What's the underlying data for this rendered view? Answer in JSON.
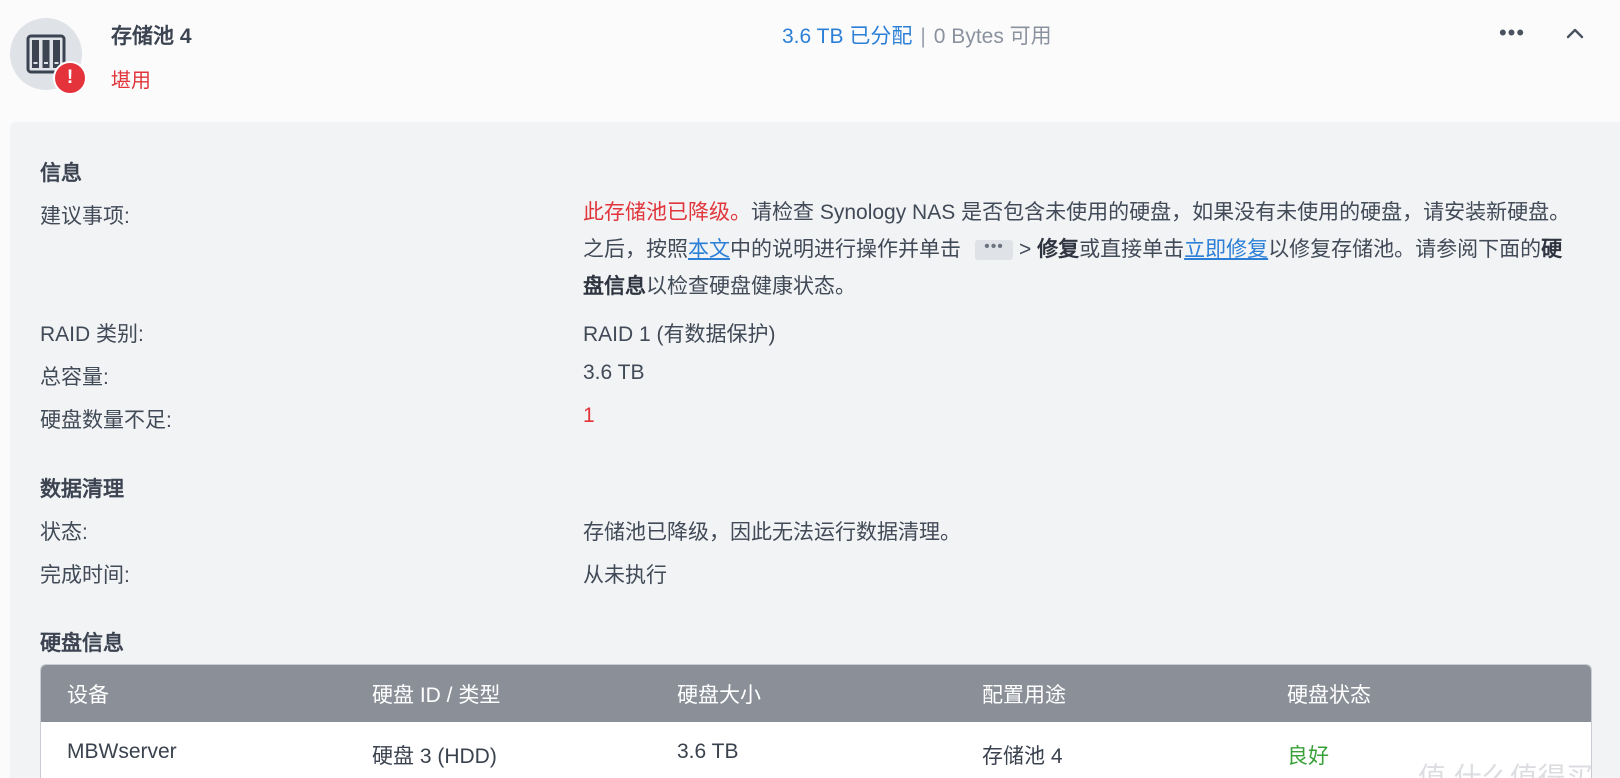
{
  "pool": {
    "title": "存储池 4",
    "status": "堪用",
    "allocated": "3.6 TB 已分配",
    "separator": "|",
    "available": "0 Bytes 可用",
    "more_label": "•••",
    "collapse_label": "^"
  },
  "info": {
    "section_title": "信息",
    "advice_label": "建议事项:",
    "advice": {
      "warning": "此存储池已降级。",
      "text1": "请检查 Synology NAS 是否包含未使用的硬盘，如果没有未使用的硬盘，请安装新硬盘。之后，按照",
      "link1": "本文",
      "text2": "中的说明进行操作并单击",
      "more_glyph": "•••",
      "text3": "> ",
      "bold1": "修复",
      "text4": "或直接单击",
      "link2": "立即修复",
      "text5": "以修复存储池。请参阅下面的",
      "bold2": "硬盘信息",
      "text6": "以检查硬盘健康状态。"
    },
    "raid_label": "RAID 类别:",
    "raid_value": "RAID 1 (有数据保护)",
    "capacity_label": "总容量:",
    "capacity_value": "3.6 TB",
    "missing_label": "硬盘数量不足:",
    "missing_value": "1"
  },
  "scrub": {
    "section_title": "数据清理",
    "status_label": "状态:",
    "status_value": "存储池已降级，因此无法运行数据清理。",
    "time_label": "完成时间:",
    "time_value": "从未执行"
  },
  "disks": {
    "section_title": "硬盘信息",
    "columns": [
      "设备",
      "硬盘 ID / 类型",
      "硬盘大小",
      "配置用途",
      "硬盘状态"
    ],
    "rows": [
      [
        "MBWserver",
        "硬盘 3 (HDD)",
        "3.6 TB",
        "存储池 4",
        "良好"
      ]
    ]
  },
  "watermark": "值 什么值得买",
  "colors": {
    "danger": "#e0363c",
    "link": "#2c7fd6",
    "good": "#3aa13a",
    "table_header": "#8b9098"
  },
  "icons": {
    "pool": "storage-pool-icon",
    "warning": "warning-badge-icon",
    "more": "more-horizontal-icon",
    "collapse": "chevron-up-icon"
  }
}
